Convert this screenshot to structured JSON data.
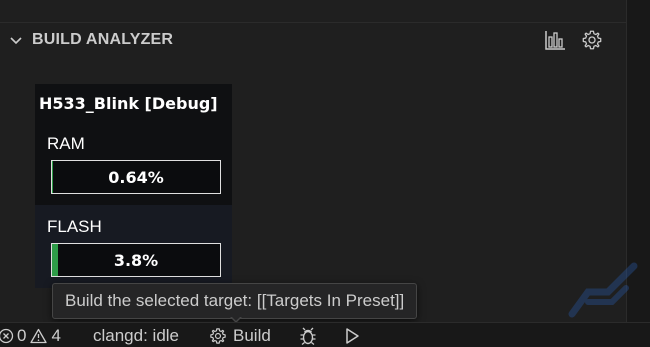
{
  "panel": {
    "title": "BUILD ANALYZER",
    "icons": [
      "bar-chart-icon",
      "gear-icon"
    ]
  },
  "card": {
    "title": "H533_Blink [Debug]",
    "ram": {
      "label": "RAM",
      "usage_text": "0.64%",
      "usage": 0.0064
    },
    "flash": {
      "label": "FLASH",
      "usage_text": "3.8%",
      "usage": 0.038
    }
  },
  "tooltip": {
    "text": "Build the selected target: [[Targets In Preset]]"
  },
  "statusbar": {
    "errors": "0",
    "warnings": "4",
    "clangd": "clangd: idle",
    "build_label": "Build"
  },
  "colors": {
    "background": "#1f1f1f",
    "card_bg": "#0f1012",
    "flash_section_bg": "#171a22",
    "bar_fill": "#2e9c48",
    "statusbar_bg": "#181818"
  }
}
